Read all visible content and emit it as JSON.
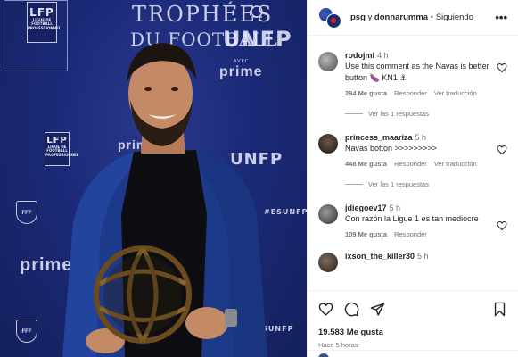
{
  "photo": {
    "wall_title_line1": "TROPHÉES",
    "wall_title_line2": "DU FOOTBALL",
    "wall_brand": "UNFP",
    "wall_avec": "AVEC",
    "wall_prime": "prime",
    "lfp_label": "LFP",
    "lfp_small": "LIGUE DE FOOTBALL PROFESSIONNEL",
    "fff_label": "FFF",
    "hashtag": "#ESUNFP",
    "hashtag2": "#ESUNFP",
    "prime_left": "prime",
    "prime_mid": "prime"
  },
  "header": {
    "user1": "psg",
    "connector": " y ",
    "user2": "donnarumma",
    "separator": " • ",
    "follow_status": "Siguiendo",
    "more": "•••"
  },
  "comments": [
    {
      "user": "rodojml",
      "time": "4 h",
      "text": "Use this comment as the Navas is better button 🍆 KN1 ⚓",
      "likes": "294 Me gusta",
      "reply": "Responder",
      "translate": "Ver traducción",
      "replies": "Ver las 1 respuestas"
    },
    {
      "user": "princess_maariza",
      "time": "5 h",
      "text": "Navas botton >>>>>>>>>",
      "likes": "448 Me gusta",
      "reply": "Responder",
      "translate": "Ver traducción",
      "replies": "Ver las 1 respuestas"
    },
    {
      "user": "jdiegoev17",
      "time": "5 h",
      "text": "Con razón la Ligue 1 es tan mediocre",
      "likes": "109 Me gusta",
      "reply": "Responder"
    },
    {
      "user": "ixson_the_killer30",
      "time": "5 h"
    }
  ],
  "footer": {
    "likes": "19.583 Me gusta",
    "time": "Hace 5 horas"
  },
  "icons": [
    "more-icon",
    "heart-icon",
    "comment-icon",
    "share-icon",
    "save-icon"
  ],
  "colors": {
    "wall_blue": "#1b2a78",
    "text": "#262626",
    "muted": "#737373"
  }
}
